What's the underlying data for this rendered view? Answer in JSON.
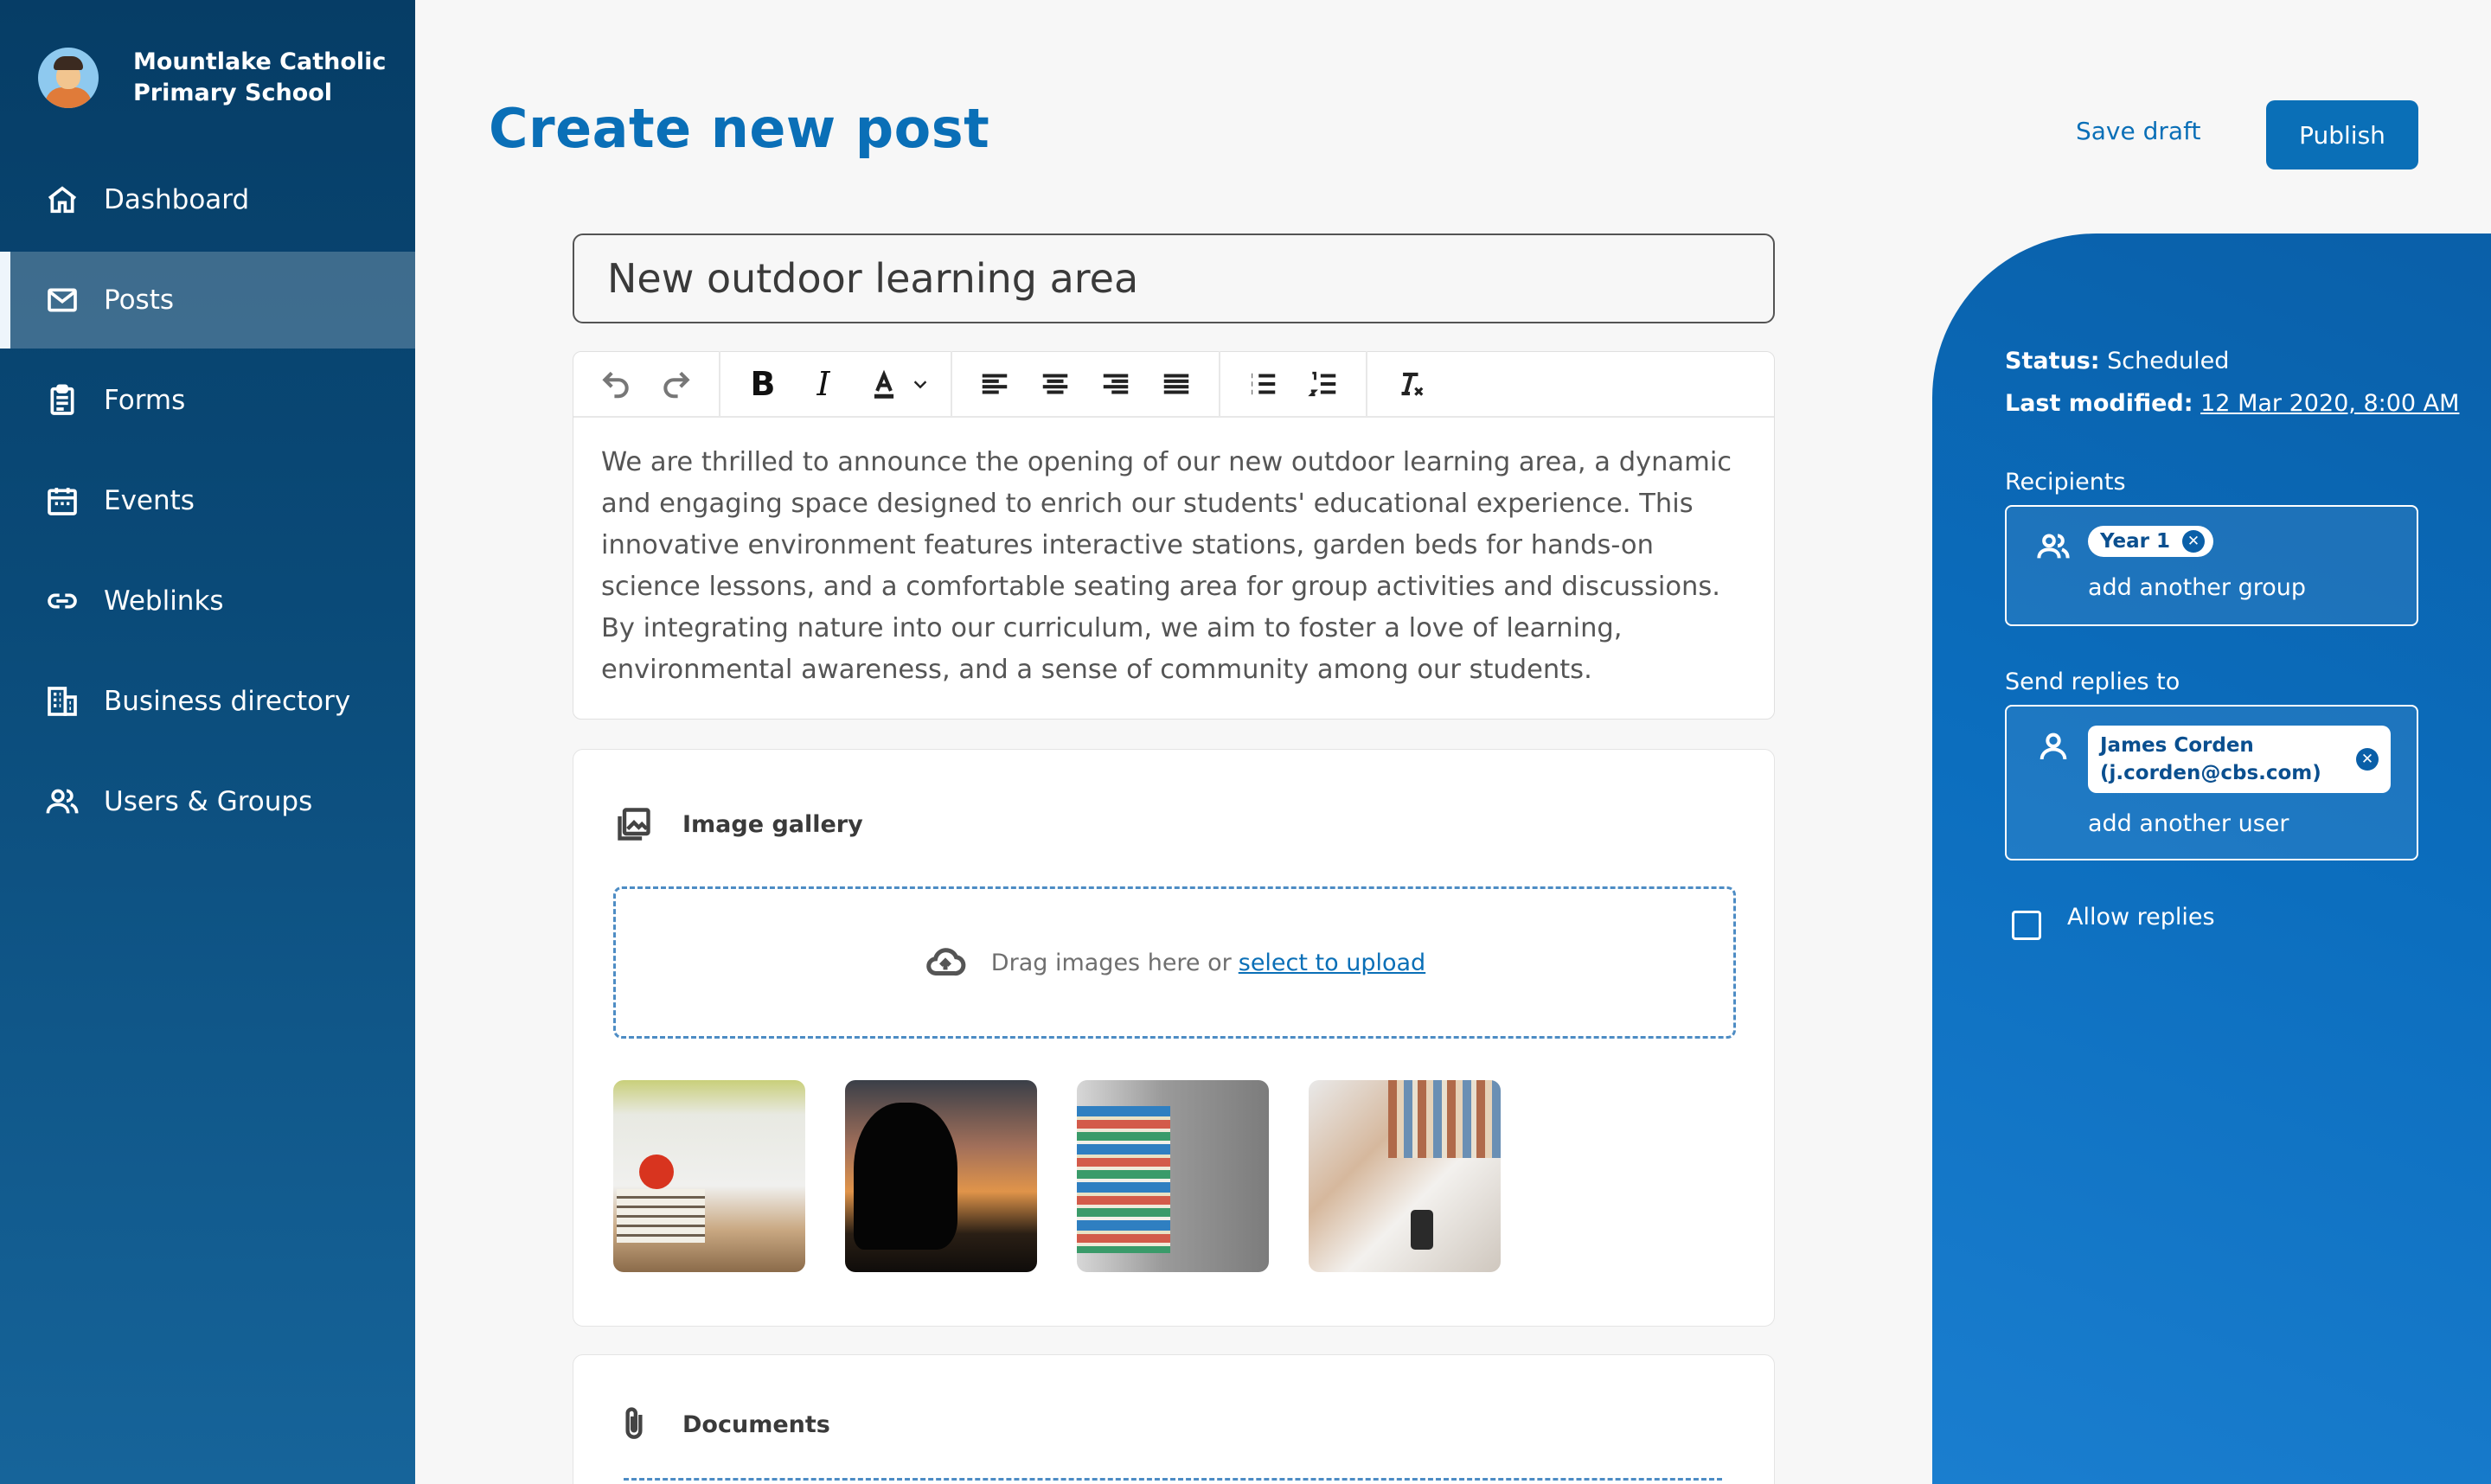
{
  "app": {
    "school_name_line1": "Mountlake Catholic",
    "school_name_line2": "Primary School"
  },
  "sidebar": {
    "items": [
      {
        "label": "Dashboard",
        "icon": "home-icon",
        "active": false
      },
      {
        "label": "Posts",
        "icon": "envelope-icon",
        "active": true
      },
      {
        "label": "Forms",
        "icon": "clipboard-icon",
        "active": false
      },
      {
        "label": "Events",
        "icon": "calendar-icon",
        "active": false
      },
      {
        "label": "Weblinks",
        "icon": "link-icon",
        "active": false
      },
      {
        "label": "Business directory",
        "icon": "building-icon",
        "active": false
      },
      {
        "label": "Users & Groups",
        "icon": "users-icon",
        "active": false
      }
    ]
  },
  "header": {
    "title": "Create new post",
    "save_draft": "Save draft",
    "publish": "Publish"
  },
  "post": {
    "title": "New outdoor learning area",
    "body": "We are thrilled to announce the opening of our new outdoor learning area, a dynamic and engaging space designed to enrich our students' educational experience. This innovative environment features interactive stations, garden beds for hands-on science lessons, and a comfortable seating area for group activities and discussions. By integrating nature into our curriculum, we aim to foster a love of learning, environmental awareness, and a sense of community among our students."
  },
  "toolbar": {
    "buttons": [
      "undo-icon",
      "redo-icon",
      "bold-icon",
      "italic-icon",
      "font-color-icon",
      "chevron-down-icon",
      "align-left-icon",
      "align-center-icon",
      "align-right-icon",
      "align-justify-icon",
      "bullet-list-icon",
      "numbered-list-icon",
      "clear-format-icon"
    ]
  },
  "gallery": {
    "heading": "Image gallery",
    "drop_text": "Drag images here or",
    "drop_link": "select to upload",
    "images": [
      "apple-on-books",
      "reading-silhouette",
      "book-stack",
      "desk-with-books"
    ]
  },
  "documents": {
    "heading": "Documents"
  },
  "panel": {
    "status_label": "Status:",
    "status_value": "Scheduled",
    "modified_label": "Last modified:",
    "modified_value": "12 Mar 2020, 8:00 AM",
    "recipients_label": "Recipients",
    "recipient_chip": "Year 1",
    "add_group": "add another group",
    "replies_label": "Send replies to",
    "reply_user_line1": "James Corden",
    "reply_user_line2": "(j.corden@cbs.com)",
    "add_user": "add another user",
    "allow_replies": "Allow replies",
    "allow_replies_checked": false
  },
  "colors": {
    "accent": "#0a6fb7",
    "sidebar_top": "#063d66",
    "panel": "#0b6dbd"
  }
}
